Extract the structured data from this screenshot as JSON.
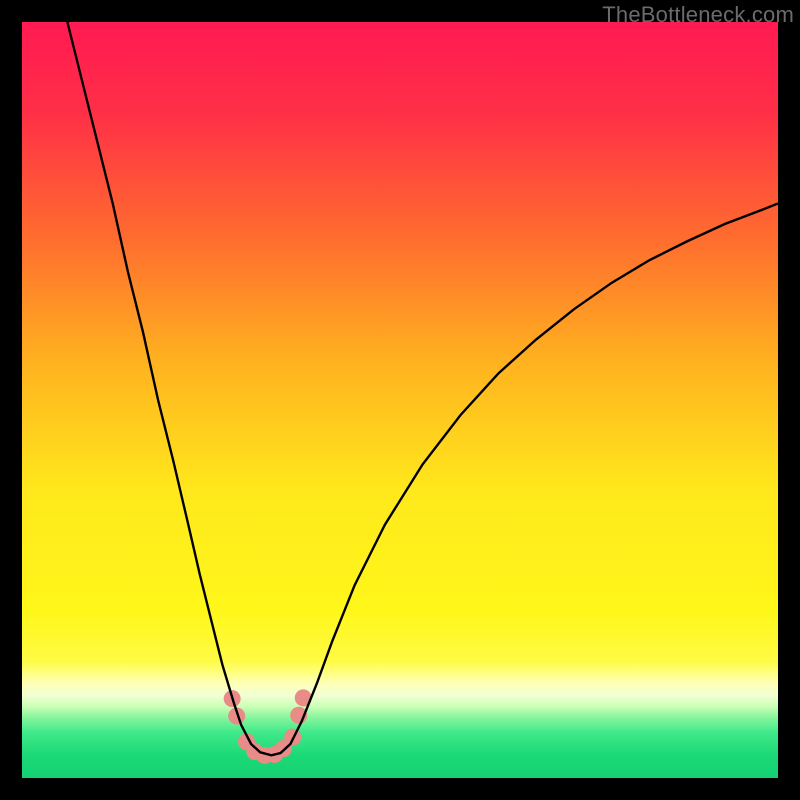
{
  "watermark": "TheBottleneck.com",
  "chart_data": {
    "type": "line",
    "title": "",
    "xlabel": "",
    "ylabel": "",
    "xlim": [
      0,
      100
    ],
    "ylim": [
      0,
      100
    ],
    "gradient_stops": [
      {
        "offset": 0.0,
        "color": "#ff1a52"
      },
      {
        "offset": 0.12,
        "color": "#ff2f47"
      },
      {
        "offset": 0.28,
        "color": "#ff6a2f"
      },
      {
        "offset": 0.45,
        "color": "#ffb21f"
      },
      {
        "offset": 0.62,
        "color": "#ffe81c"
      },
      {
        "offset": 0.78,
        "color": "#fff71a"
      },
      {
        "offset": 0.845,
        "color": "#fffa44"
      },
      {
        "offset": 0.86,
        "color": "#ffff7d"
      },
      {
        "offset": 0.875,
        "color": "#fdffb8"
      },
      {
        "offset": 0.89,
        "color": "#f3ffd4"
      },
      {
        "offset": 0.905,
        "color": "#ccffb8"
      },
      {
        "offset": 0.92,
        "color": "#87f59d"
      },
      {
        "offset": 0.94,
        "color": "#3fe989"
      },
      {
        "offset": 0.97,
        "color": "#1cd977"
      },
      {
        "offset": 1.0,
        "color": "#14d172"
      }
    ],
    "series": [
      {
        "name": "bottleneck-curve",
        "color": "#000000",
        "width": 2.4,
        "x": [
          6.0,
          8.0,
          10.0,
          12.0,
          14.0,
          16.0,
          18.0,
          20.0,
          22.0,
          23.5,
          25.0,
          26.5,
          28.0,
          29.0,
          30.3,
          31.5,
          33.0,
          34.2,
          35.5,
          37.0,
          39.0,
          41.0,
          44.0,
          48.0,
          53.0,
          58.0,
          63.0,
          68.0,
          73.0,
          78.0,
          83.0,
          88.0,
          93.0,
          98.0,
          100.0
        ],
        "y": [
          100.0,
          92.0,
          84.0,
          76.0,
          67.0,
          59.0,
          50.0,
          42.0,
          33.5,
          27.0,
          21.0,
          15.0,
          10.0,
          7.0,
          4.5,
          3.4,
          3.0,
          3.3,
          4.5,
          7.5,
          12.5,
          18.0,
          25.5,
          33.5,
          41.5,
          48.0,
          53.5,
          58.0,
          62.0,
          65.5,
          68.5,
          71.0,
          73.3,
          75.2,
          76.0
        ]
      }
    ],
    "markers": {
      "name": "highlight-dots",
      "color": "#e98b86",
      "radius": 8.5,
      "points": [
        {
          "x": 27.8,
          "y": 10.5
        },
        {
          "x": 28.4,
          "y": 8.2
        },
        {
          "x": 29.7,
          "y": 4.8
        },
        {
          "x": 30.8,
          "y": 3.5
        },
        {
          "x": 32.1,
          "y": 3.0
        },
        {
          "x": 33.4,
          "y": 3.1
        },
        {
          "x": 34.6,
          "y": 3.9
        },
        {
          "x": 35.8,
          "y": 5.4
        },
        {
          "x": 36.6,
          "y": 8.3
        },
        {
          "x": 37.2,
          "y": 10.6
        }
      ]
    }
  }
}
